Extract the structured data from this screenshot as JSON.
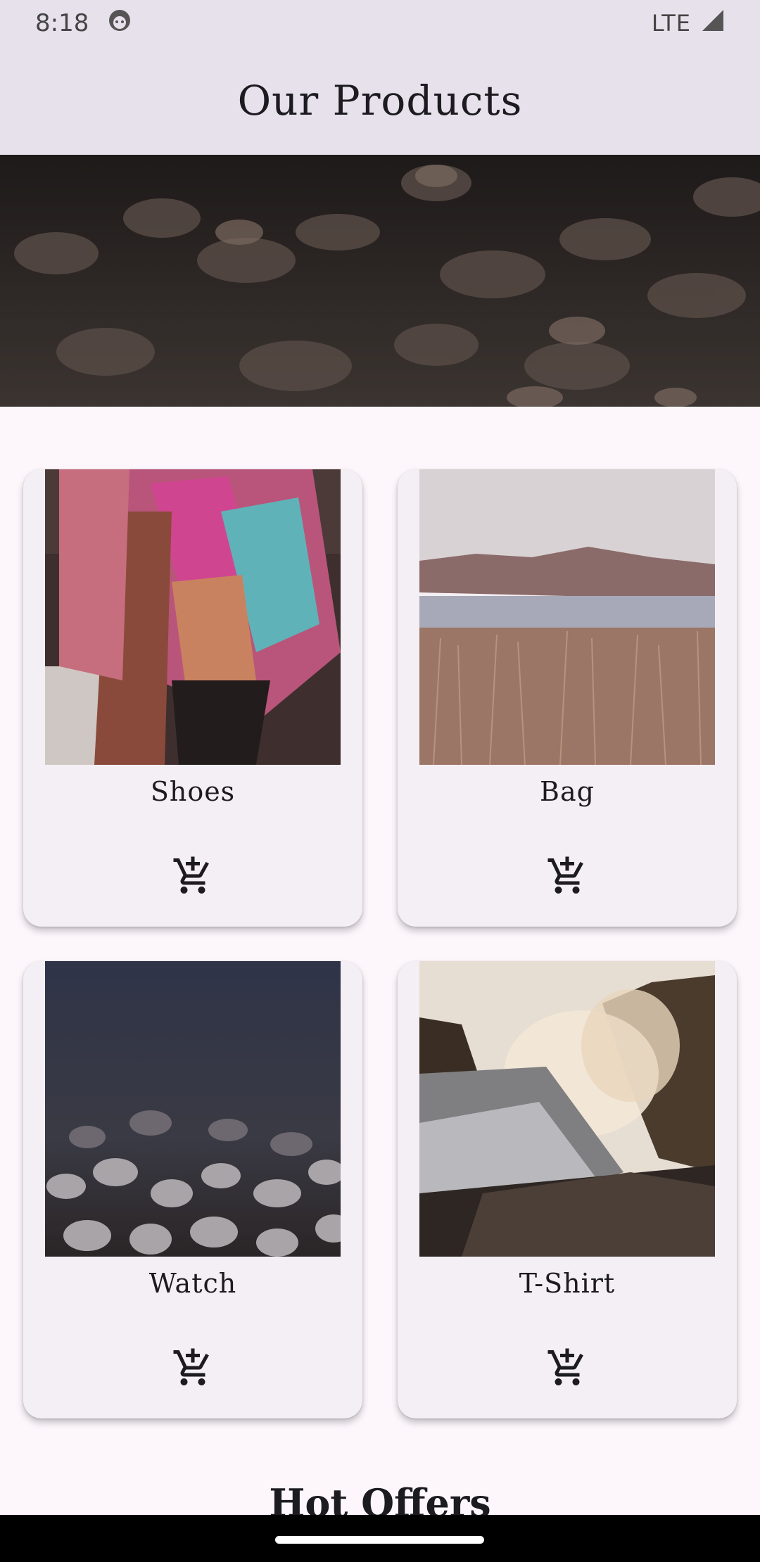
{
  "status_bar": {
    "time": "8:18",
    "network": "LTE",
    "icons": [
      "face-notification-icon",
      "signal-icon"
    ]
  },
  "app_bar": {
    "title": "Our Products"
  },
  "banner": {
    "image": "pebbles-banner-image"
  },
  "products": [
    {
      "label": "Shoes",
      "image": "scarf-photo",
      "cart_icon": "add-shopping-cart-icon"
    },
    {
      "label": "Bag",
      "image": "lake-field-photo",
      "cart_icon": "add-shopping-cart-icon"
    },
    {
      "label": "Watch",
      "image": "pebbles-photo",
      "cart_icon": "add-shopping-cart-icon"
    },
    {
      "label": "T-Shirt",
      "image": "waterfall-photo",
      "cart_icon": "add-shopping-cart-icon"
    }
  ],
  "sections": {
    "hot_offers_title": "Hot Offers"
  },
  "colors": {
    "app_bar_bg": "#e7e1ec",
    "background": "#fdf7fc",
    "card_bg": "#f4eff4",
    "text": "#1c1b1f"
  }
}
